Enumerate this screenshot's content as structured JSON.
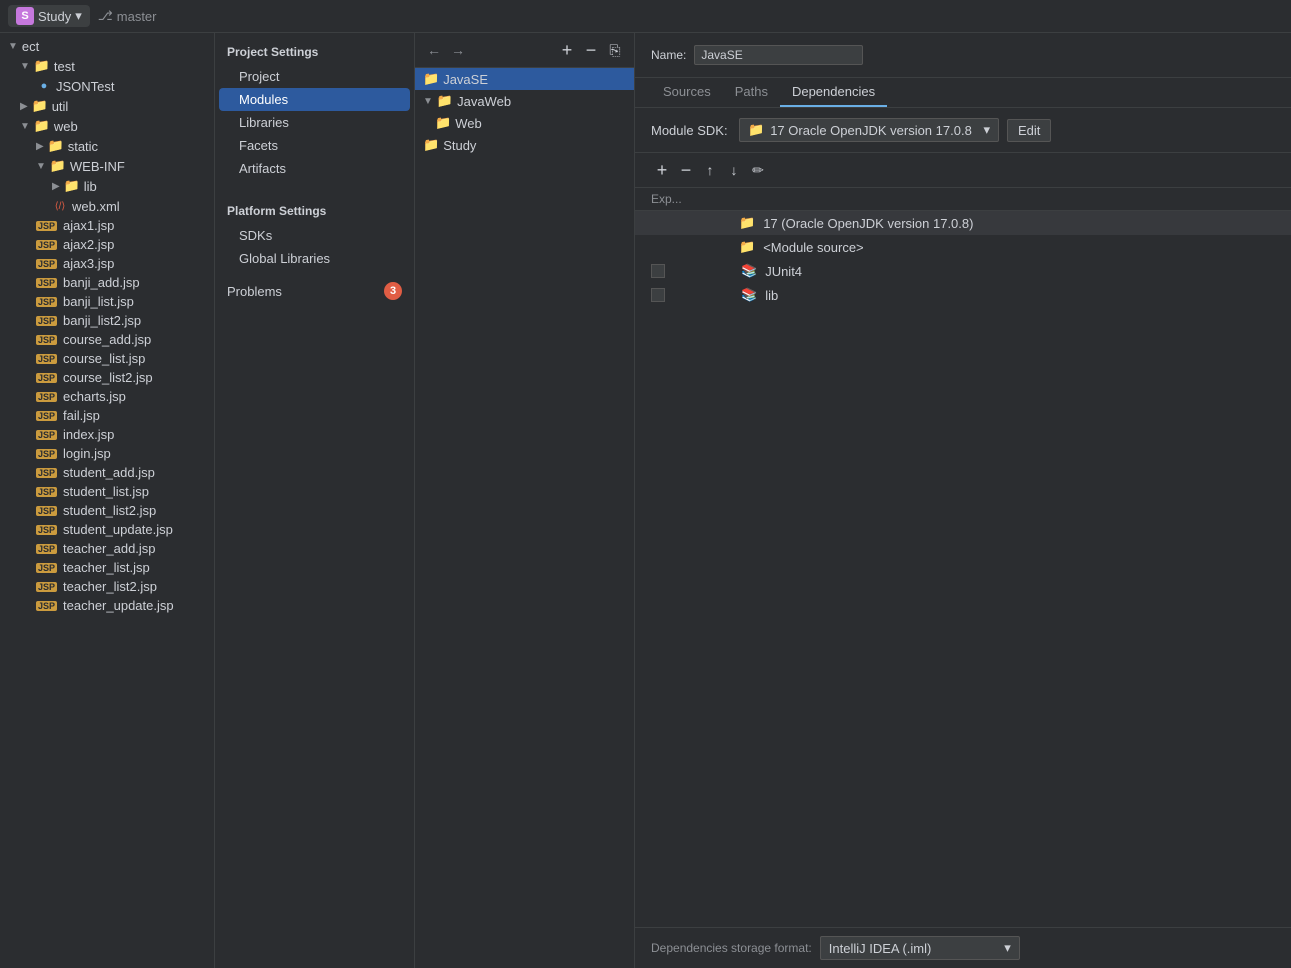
{
  "topbar": {
    "project_name": "Study",
    "s_icon": "S",
    "branch_icon": "⎇",
    "branch_name": "master"
  },
  "filetree": {
    "items": [
      {
        "id": "project-root",
        "label": "ect",
        "indent": 0,
        "type": "project",
        "chevron": "▼"
      },
      {
        "id": "test",
        "label": "test",
        "indent": 1,
        "type": "folder",
        "chevron": "▼"
      },
      {
        "id": "jsontest",
        "label": "JSONTest",
        "indent": 2,
        "type": "java"
      },
      {
        "id": "util",
        "label": "util",
        "indent": 1,
        "type": "folder",
        "chevron": "▶"
      },
      {
        "id": "web",
        "label": "web",
        "indent": 1,
        "type": "folder",
        "chevron": "▼"
      },
      {
        "id": "static",
        "label": "static",
        "indent": 2,
        "type": "folder",
        "chevron": "▶"
      },
      {
        "id": "web-inf",
        "label": "WEB-INF",
        "indent": 2,
        "type": "folder",
        "chevron": "▼"
      },
      {
        "id": "lib",
        "label": "lib",
        "indent": 3,
        "type": "folder",
        "chevron": "▶"
      },
      {
        "id": "web-xml",
        "label": "web.xml",
        "indent": 3,
        "type": "xml"
      },
      {
        "id": "ajax1",
        "label": "ajax1.jsp",
        "indent": 2,
        "type": "jsp"
      },
      {
        "id": "ajax2",
        "label": "ajax2.jsp",
        "indent": 2,
        "type": "jsp"
      },
      {
        "id": "ajax3",
        "label": "ajax3.jsp",
        "indent": 2,
        "type": "jsp"
      },
      {
        "id": "banji_add",
        "label": "banji_add.jsp",
        "indent": 2,
        "type": "jsp"
      },
      {
        "id": "banji_list",
        "label": "banji_list.jsp",
        "indent": 2,
        "type": "jsp"
      },
      {
        "id": "banji_list2",
        "label": "banji_list2.jsp",
        "indent": 2,
        "type": "jsp"
      },
      {
        "id": "course_add",
        "label": "course_add.jsp",
        "indent": 2,
        "type": "jsp"
      },
      {
        "id": "course_list",
        "label": "course_list.jsp",
        "indent": 2,
        "type": "jsp"
      },
      {
        "id": "course_list2",
        "label": "course_list2.jsp",
        "indent": 2,
        "type": "jsp"
      },
      {
        "id": "echarts",
        "label": "echarts.jsp",
        "indent": 2,
        "type": "jsp"
      },
      {
        "id": "fail",
        "label": "fail.jsp",
        "indent": 2,
        "type": "jsp"
      },
      {
        "id": "index",
        "label": "index.jsp",
        "indent": 2,
        "type": "jsp"
      },
      {
        "id": "login",
        "label": "login.jsp",
        "indent": 2,
        "type": "jsp"
      },
      {
        "id": "student_add",
        "label": "student_add.jsp",
        "indent": 2,
        "type": "jsp"
      },
      {
        "id": "student_list",
        "label": "student_list.jsp",
        "indent": 2,
        "type": "jsp"
      },
      {
        "id": "student_list2",
        "label": "student_list2.jsp",
        "indent": 2,
        "type": "jsp"
      },
      {
        "id": "student_update",
        "label": "student_update.jsp",
        "indent": 2,
        "type": "jsp"
      },
      {
        "id": "teacher_add",
        "label": "teacher_add.jsp",
        "indent": 2,
        "type": "jsp"
      },
      {
        "id": "teacher_list",
        "label": "teacher_list.jsp",
        "indent": 2,
        "type": "jsp"
      },
      {
        "id": "teacher_list2",
        "label": "teacher_list2.jsp",
        "indent": 2,
        "type": "jsp"
      },
      {
        "id": "teacher_update",
        "label": "teacher_update.jsp",
        "indent": 2,
        "type": "jsp"
      }
    ]
  },
  "settings": {
    "project_section": "Project Settings",
    "items": [
      {
        "id": "project",
        "label": "Project"
      },
      {
        "id": "modules",
        "label": "Modules",
        "selected": true
      },
      {
        "id": "libraries",
        "label": "Libraries"
      },
      {
        "id": "facets",
        "label": "Facets"
      },
      {
        "id": "artifacts",
        "label": "Artifacts"
      }
    ],
    "platform_section": "Platform Settings",
    "platform_items": [
      {
        "id": "sdks",
        "label": "SDKs"
      },
      {
        "id": "global-libraries",
        "label": "Global Libraries"
      }
    ],
    "problems_label": "Problems",
    "problems_count": "3"
  },
  "module_tree": {
    "toolbar_add": "+",
    "toolbar_remove": "−",
    "toolbar_copy": "⎘",
    "nav_back": "←",
    "nav_forward": "→",
    "modules": [
      {
        "id": "javase",
        "label": "JavaSE",
        "selected": true,
        "indent": 0,
        "chevron": ""
      },
      {
        "id": "javaweb",
        "label": "JavaWeb",
        "indent": 0,
        "chevron": "▼"
      },
      {
        "id": "web-module",
        "label": "Web",
        "indent": 1,
        "chevron": ""
      },
      {
        "id": "study-module",
        "label": "Study",
        "indent": 0,
        "chevron": ""
      }
    ]
  },
  "details": {
    "name_label": "Name:",
    "name_value": "JavaSE",
    "tabs": [
      {
        "id": "sources",
        "label": "Sources"
      },
      {
        "id": "paths",
        "label": "Paths"
      },
      {
        "id": "dependencies",
        "label": "Dependencies",
        "active": true
      }
    ],
    "sdk_label": "Module SDK:",
    "sdk_icon": "📁",
    "sdk_value": "17  Oracle OpenJDK version 17.0.8",
    "sdk_edit": "Edit",
    "deps_col_header": "Exp...",
    "dependencies": [
      {
        "id": "jdk",
        "label": "17 (Oracle OpenJDK version 17.0.8)",
        "type": "jdk",
        "checked": false,
        "has_check": false
      },
      {
        "id": "module-source",
        "label": "<Module source>",
        "type": "source",
        "checked": false,
        "has_check": false
      },
      {
        "id": "junit4",
        "label": "JUnit4",
        "type": "lib",
        "checked": false,
        "has_check": true
      },
      {
        "id": "lib",
        "label": "lib",
        "type": "lib",
        "checked": false,
        "has_check": true
      }
    ],
    "bottom_label": "Dependencies storage format:",
    "bottom_value": "IntelliJ IDEA (.iml)",
    "bottom_chevron": "▼"
  }
}
